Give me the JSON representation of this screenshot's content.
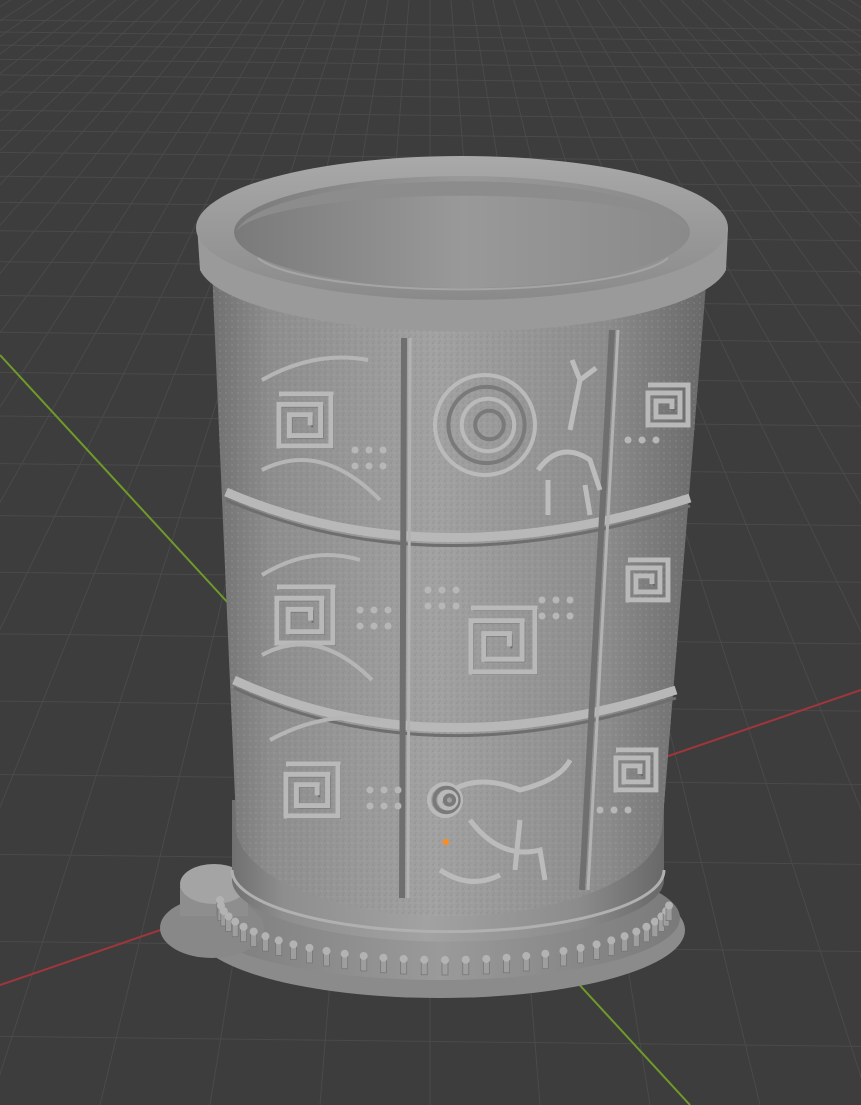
{
  "app": {
    "view": "3d-viewport",
    "shading_mode": "solid"
  },
  "viewport": {
    "background_color": "#3d3d3d",
    "grid": {
      "visible": true,
      "line_color": "#4a4a4a"
    },
    "axes": {
      "x_axis_color": "#a0363c",
      "y_axis_color": "#6f9a2a"
    },
    "origin_marker_color": "#ff8c1a"
  },
  "object": {
    "kind": "cylindrical-vessel",
    "surface_color": "#8f8f8f",
    "panel_motifs": [
      "spiral-square",
      "spiral-circle-with-deer",
      "spiral-square",
      "spiral-square",
      "dragon-figure",
      "spiral-square"
    ]
  }
}
